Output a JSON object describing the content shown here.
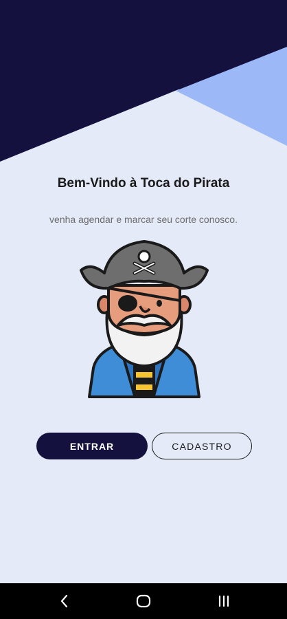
{
  "welcome": {
    "title": "Bem-Vindo à Toca do Pirata",
    "subtitle": "venha agendar e marcar seu corte conosco."
  },
  "actions": {
    "login_label": "ENTRAR",
    "register_label": "CADASTRO"
  },
  "navbar": {
    "back_icon": "back-icon",
    "home_icon": "home-icon",
    "recents_icon": "recents-icon"
  },
  "colors": {
    "background": "#E4EAF8",
    "primary_dark": "#14113F",
    "accent_light_blue": "#9DB8F7"
  }
}
